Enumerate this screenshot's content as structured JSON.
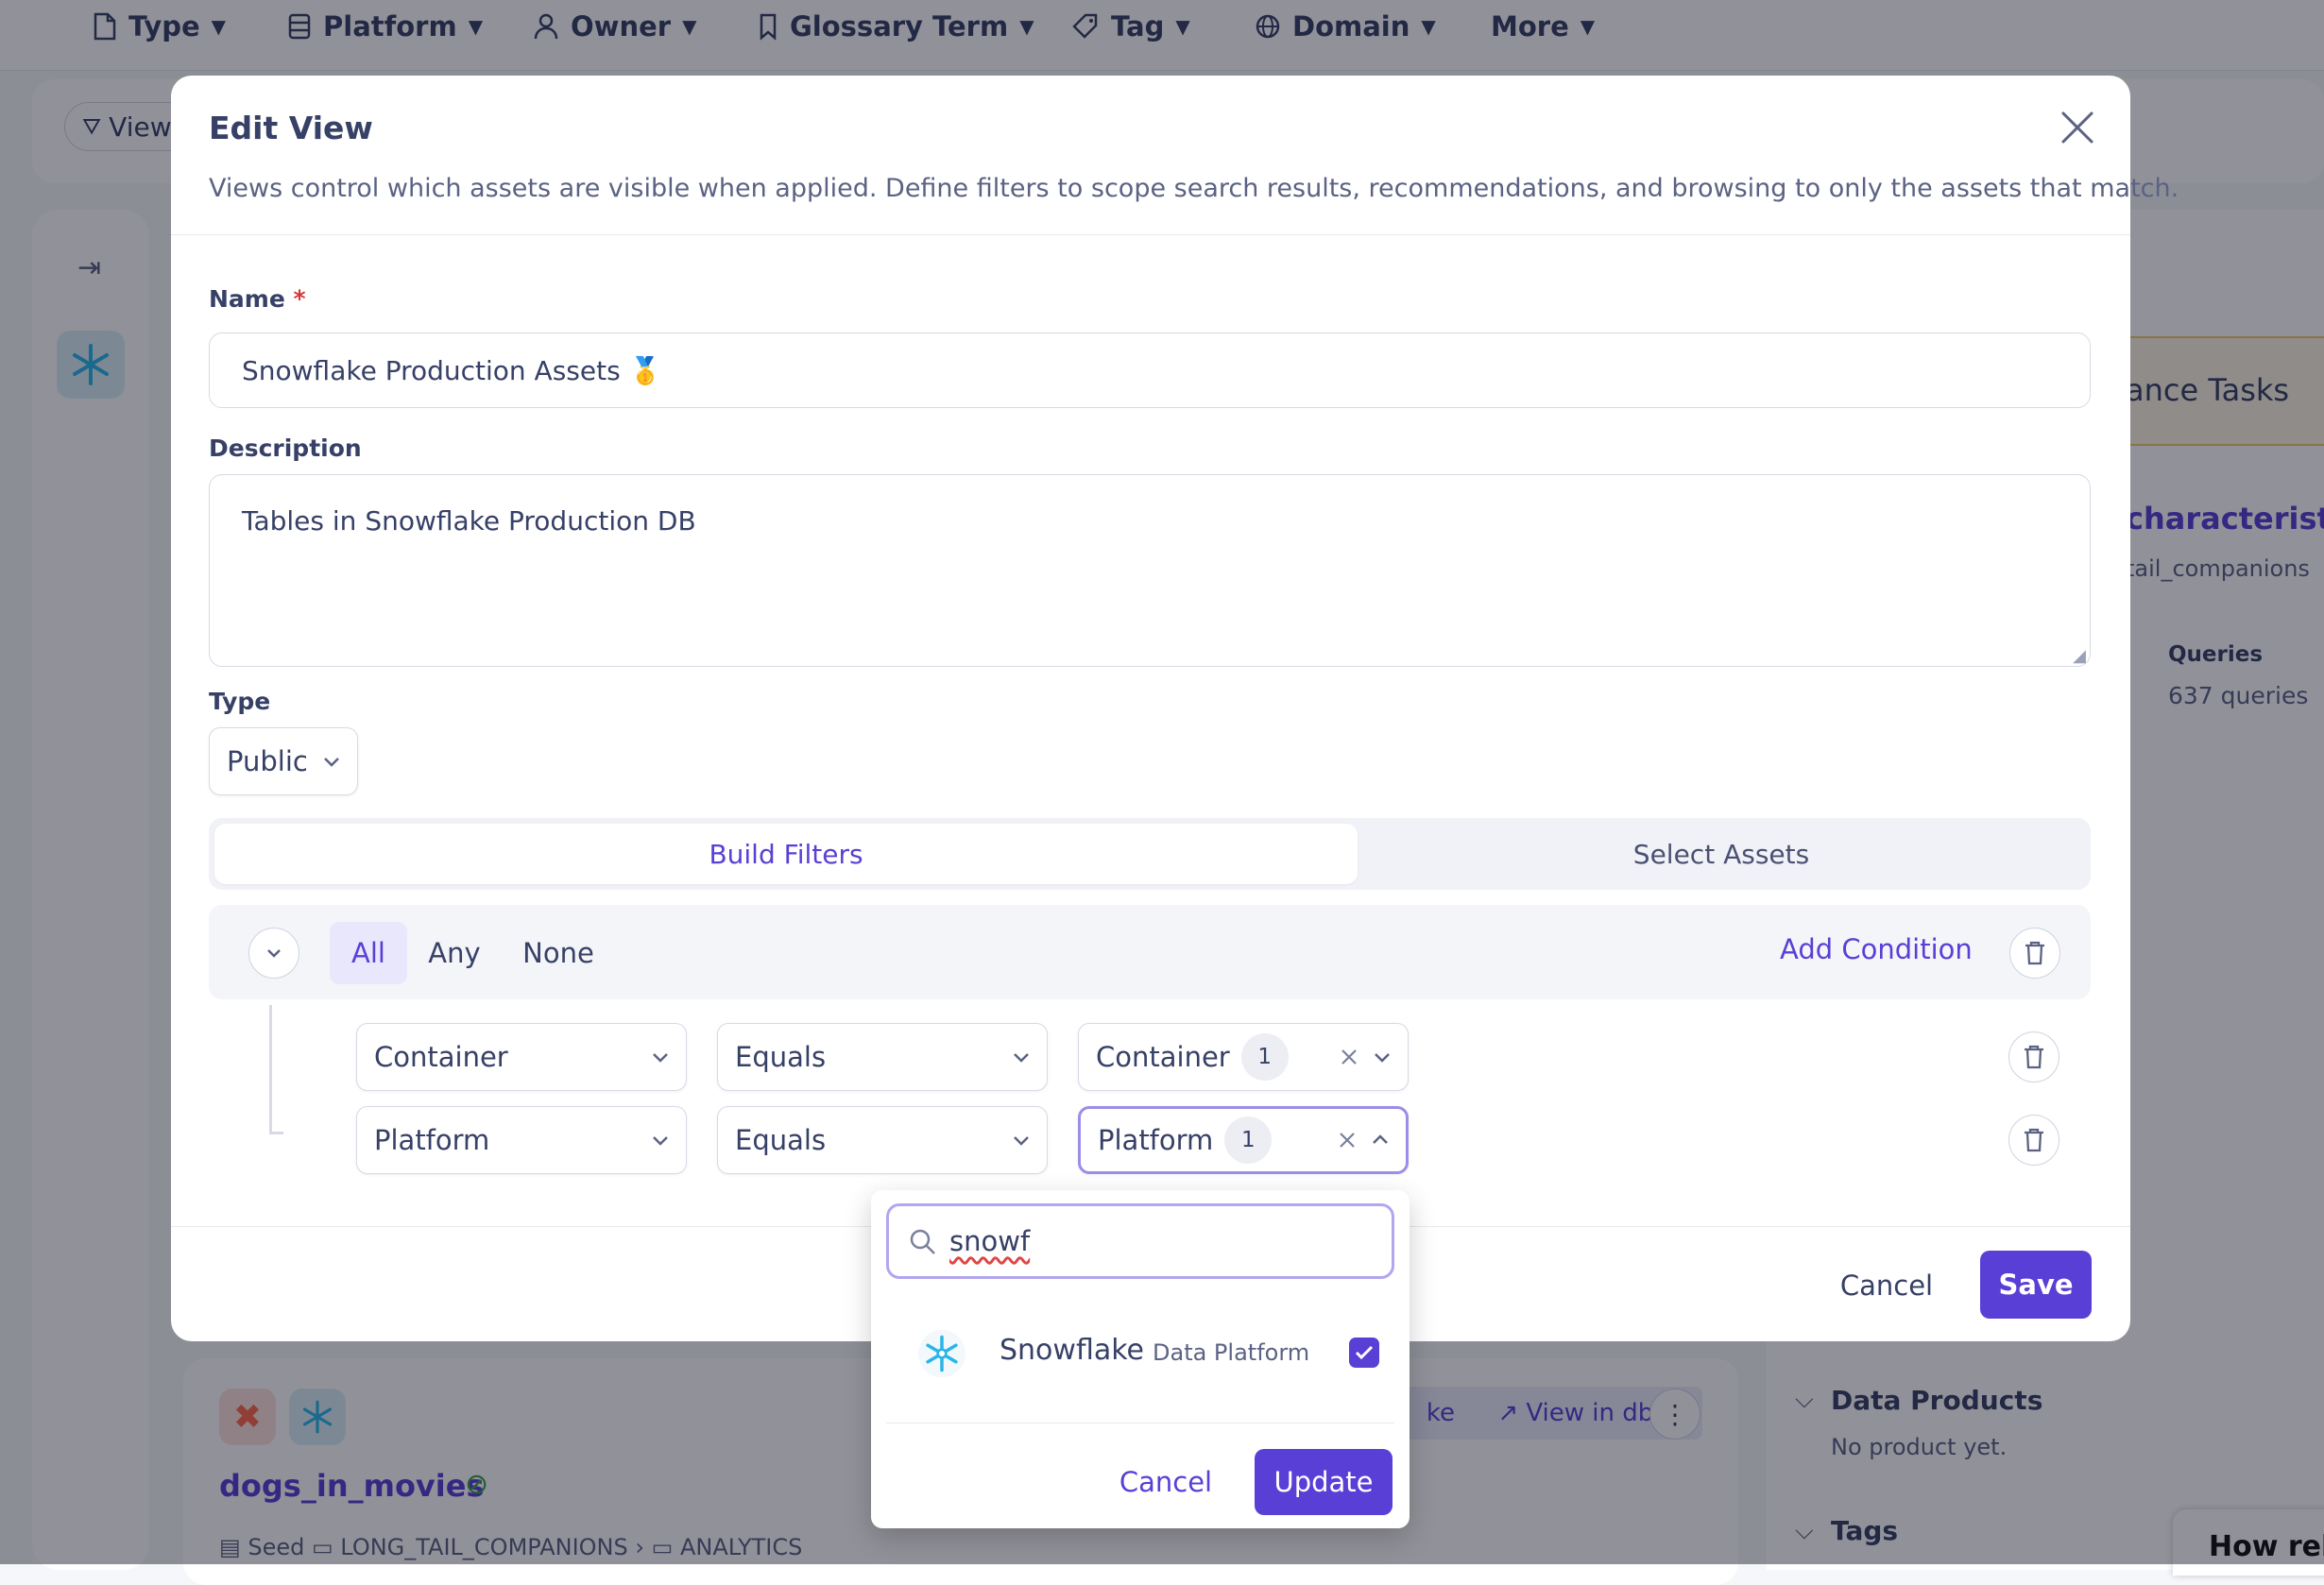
{
  "background": {
    "filters": [
      {
        "label": "Type",
        "icon": "file-icon"
      },
      {
        "label": "Platform",
        "icon": "database-icon"
      },
      {
        "label": "Owner",
        "icon": "user-icon"
      },
      {
        "label": "Glossary Term",
        "icon": "bookmark-icon"
      },
      {
        "label": "Tag",
        "icon": "tag-icon"
      },
      {
        "label": "Domain",
        "icon": "globe-icon"
      },
      {
        "label": "More",
        "icon": ""
      }
    ],
    "view_button": "View",
    "right_panel": {
      "tasks_text": "ance Tasks",
      "characteristics_link": "characteristics",
      "breadcrumb": "tail_companions",
      "queries_label": "Queries",
      "queries_value": "637 queries",
      "data_products_title": "Data Products",
      "data_products_empty": "No product yet.",
      "tags_title": "Tags",
      "feedback_text": "How rele"
    },
    "card": {
      "title": "dogs_in_movies",
      "meta": [
        "Seed",
        "LONG_TAIL_COMPANIONS",
        "ANALYTICS"
      ],
      "btn_partial": "ke",
      "view_in_dbt": "View in dbt"
    }
  },
  "modal": {
    "title": "Edit View",
    "description": "Views control which assets are visible when applied. Define filters to scope search results, recommendations, and browsing to only the assets that match.",
    "name_label": "Name",
    "required_mark": "*",
    "name_value": "Snowflake Production Assets 🥇",
    "description_label": "Description",
    "description_value": "Tables in Snowflake Production DB",
    "type_label": "Type",
    "type_value": "Public",
    "tabs": [
      "Build Filters",
      "Select Assets"
    ],
    "logic_options": [
      "All",
      "Any",
      "None"
    ],
    "logic_selected": "All",
    "add_condition": "Add Condition",
    "conditions": [
      {
        "field": "Container",
        "operator": "Equals",
        "value": "Container",
        "count": "1"
      },
      {
        "field": "Platform",
        "operator": "Equals",
        "value": "Platform",
        "count": "1"
      }
    ],
    "cancel": "Cancel",
    "save": "Save"
  },
  "dropdown": {
    "search_value": "snowf",
    "option_name": "Snowflake",
    "option_type": "Data Platform",
    "option_checked": true,
    "cancel": "Cancel",
    "update": "Update"
  },
  "colors": {
    "accent": "#5a3fd6",
    "text": "#374066",
    "muted": "#5b6283",
    "snowflake": "#29b5e8"
  }
}
